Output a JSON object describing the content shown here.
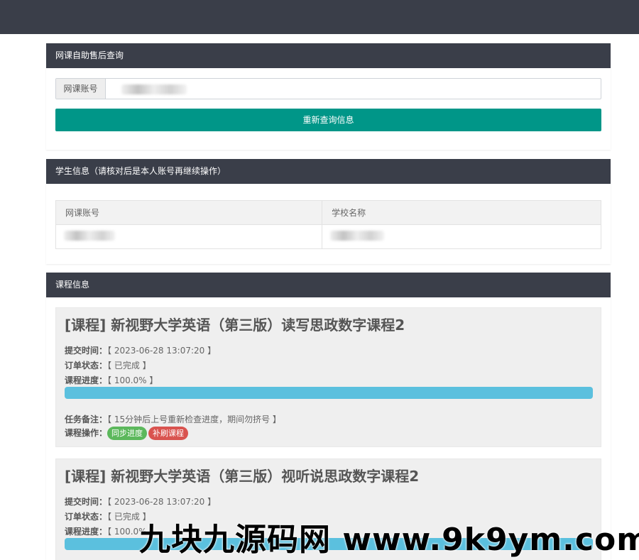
{
  "topbar": {},
  "query_panel": {
    "title": "网课自助售后查询",
    "account_label": "网课账号",
    "account_value": "",
    "button_label": "重新查询信息"
  },
  "student_panel": {
    "title": "学生信息（请核对后是本人账号再继续操作）",
    "col_account": "网课账号",
    "col_school": "学校名称"
  },
  "course_panel": {
    "title": "课程信息",
    "courses": [
      {
        "title": "[课程] 新视野大学英语（第三版）读写思政数字课程2",
        "submit_label": "提交时间：",
        "submit_value": "【 2023-06-28 13:07:20 】",
        "status_label": "订单状态：",
        "status_value": "【 已完成 】",
        "progress_label": "课程进度：",
        "progress_value": "【 100.0% 】",
        "progress_fraction": 1.0,
        "note_label": "任务备注：",
        "note_value": "【 15分钟后上号重新检查进度，期间勿挤号 】",
        "ops_label": "课程操作：",
        "op_sync": "同步进度",
        "op_redo": "补刷课程"
      },
      {
        "title": "[课程] 新视野大学英语（第三版）视听说思政数字课程2",
        "submit_label": "提交时间：",
        "submit_value": "【 2023-06-28 13:07:20 】",
        "status_label": "订单状态：",
        "status_value": "【 已完成 】",
        "progress_label": "课程进度：",
        "progress_value": "【 100.0% 】",
        "progress_fraction": 1.0
      }
    ]
  },
  "watermark": "九块九源码网 www.9k9ym.com",
  "colors": {
    "header_bg": "#3a3e49",
    "primary_button": "#009688",
    "progress": "#5bc0de",
    "tag_green": "#5cb85c",
    "tag_red": "#d9534f"
  }
}
